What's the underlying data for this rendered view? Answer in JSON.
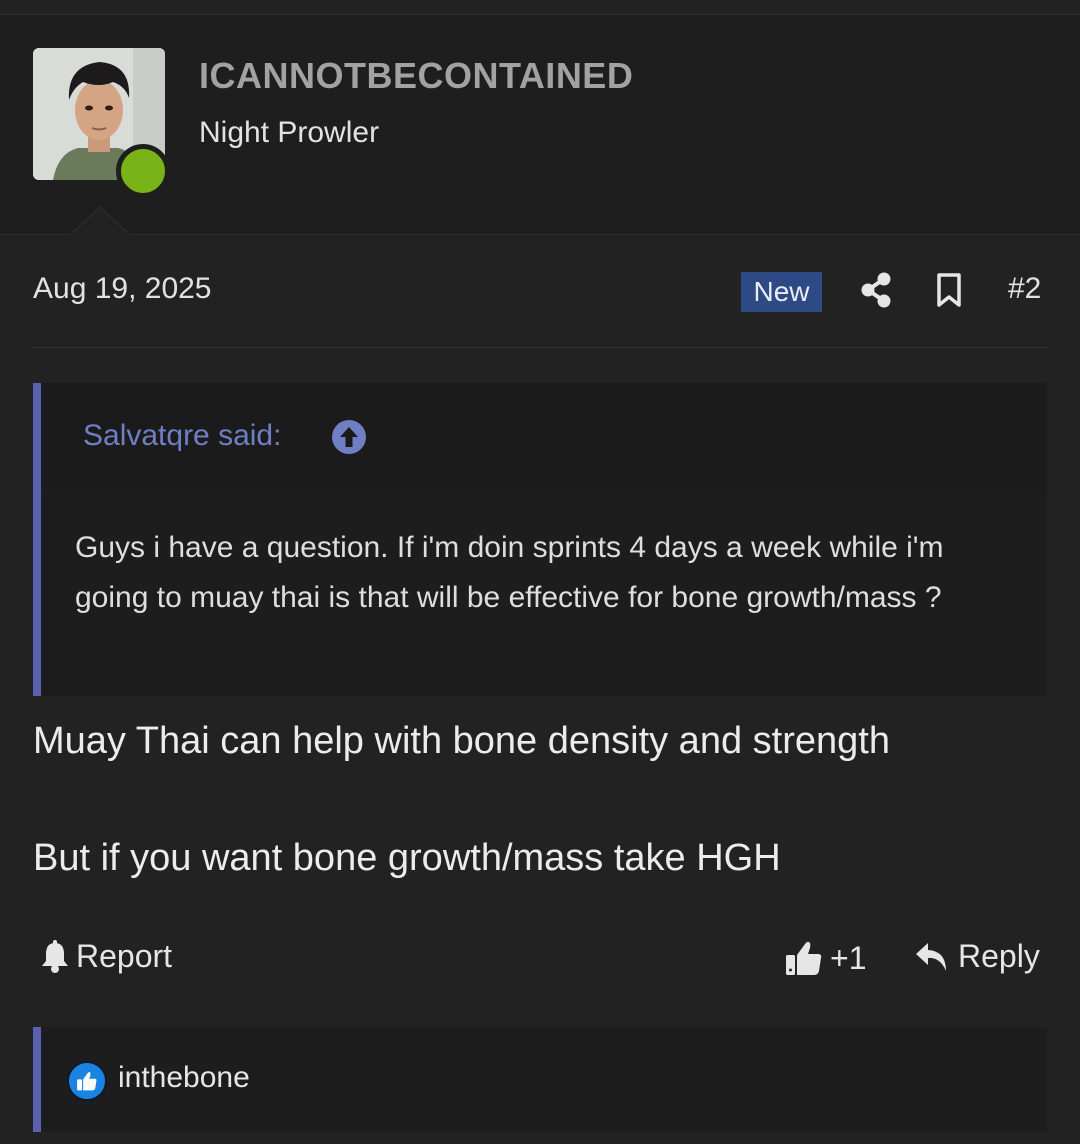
{
  "user": {
    "name": "ICANNOTBECONTAINED",
    "title": "Night Prowler"
  },
  "post": {
    "date": "Aug 19, 2025",
    "badge": "New",
    "number": "#2"
  },
  "quote": {
    "author": "Salvatqre said:",
    "text": "Guys i have a question. If i'm doin sprints 4 days a week while i'm going to muay thai is that will be effective for bone growth/mass ?"
  },
  "message": {
    "line1": "Muay Thai can help with bone density and strength",
    "line2": "But if you want bone growth/mass take HGH"
  },
  "actions": {
    "report": "Report",
    "like_count": "+1",
    "reply": "Reply"
  },
  "reactions": {
    "user": "inthebone"
  },
  "colors": {
    "online": "#7ab317",
    "badge": "#2d4a84",
    "quote_accent": "#5a62b0",
    "like": "#1a84e3"
  }
}
